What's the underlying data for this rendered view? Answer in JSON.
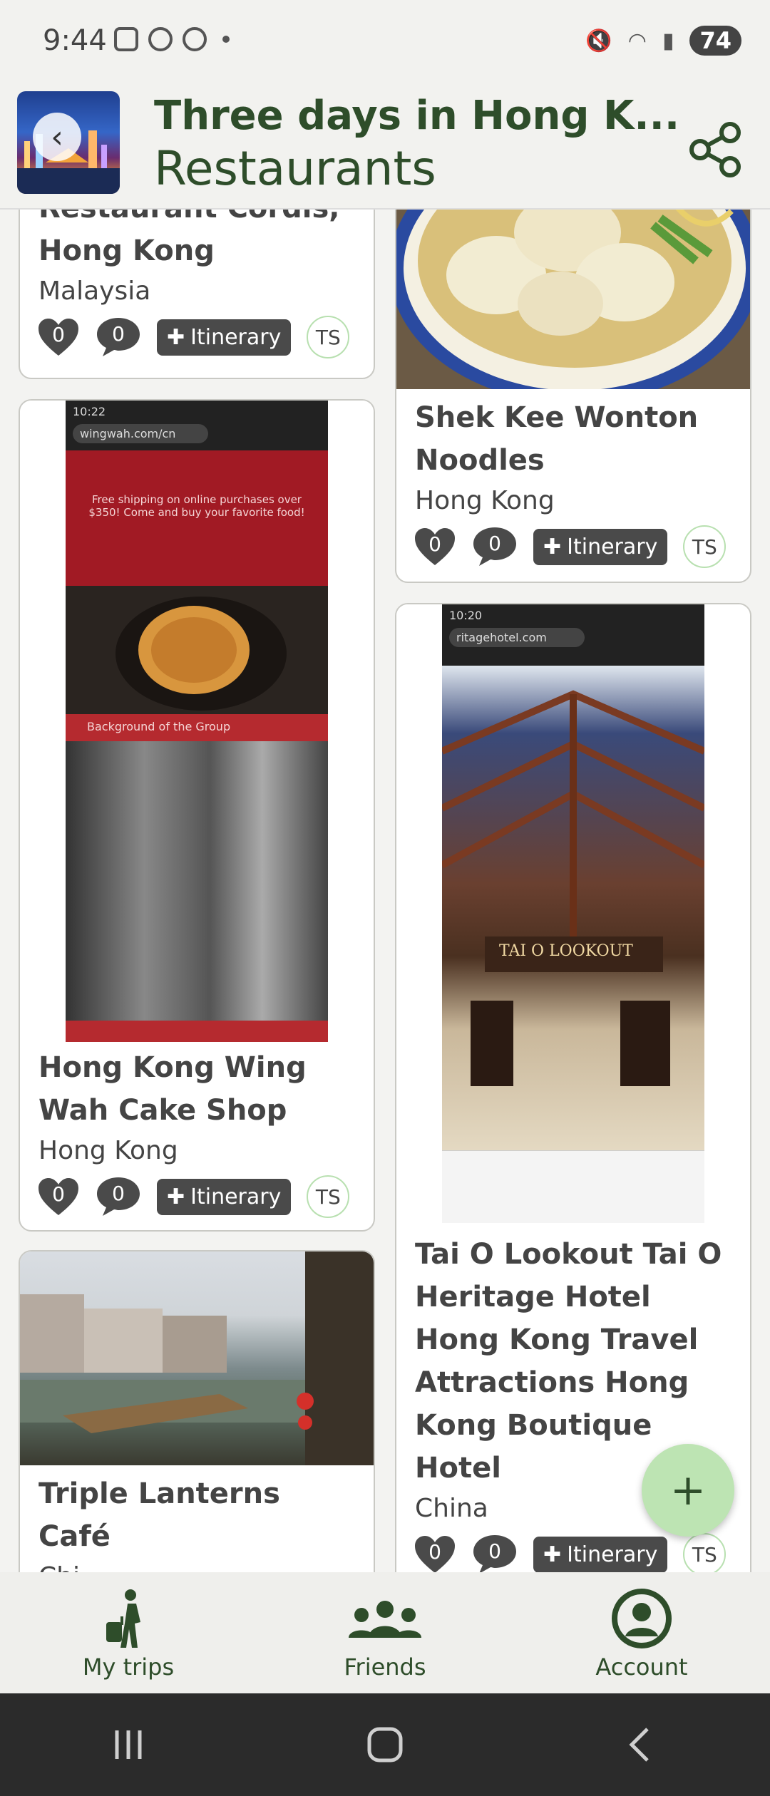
{
  "status_bar": {
    "time": "9:44",
    "battery": "74"
  },
  "header": {
    "title": "Three days in Hong K...",
    "subtitle": "Restaurants"
  },
  "cards": [
    {
      "name": "Restaurant Cordis, Hong Kong",
      "country": "Malaysia",
      "likes": "0",
      "comments": "0",
      "itinerary_label": "Itinerary",
      "user": "TS"
    },
    {
      "name": "Shek Kee Wonton Noodles",
      "country": "Hong Kong",
      "likes": "0",
      "comments": "0",
      "itinerary_label": "Itinerary",
      "user": "TS"
    },
    {
      "name": "Hong Kong Wing Wah Cake Shop",
      "country": "Hong Kong",
      "likes": "0",
      "comments": "0",
      "itinerary_label": "Itinerary",
      "user": "TS",
      "screenshot_text": {
        "url": "wingwah.com/cn",
        "banner": "Free shipping on online purchases over $350! Come and buy your favorite food!",
        "section": "Background of the Group",
        "time": "10:22"
      }
    },
    {
      "name": "Tai O Lookout Tai O Heritage Hotel Hong Kong Travel Attractions Hong Kong Boutique Hotel",
      "country": "China",
      "likes": "0",
      "comments": "0",
      "itinerary_label": "Itinerary",
      "user": "TS",
      "screenshot_text": {
        "url": "ritagehotel.com",
        "sign": "TAI O LOOKOUT",
        "time": "10:20"
      }
    },
    {
      "name": "Triple Lanterns Café",
      "country": "Chi..."
    }
  ],
  "fab": {
    "icon": "plus-icon"
  },
  "bottom_nav": [
    {
      "label": "My trips",
      "icon": "traveler-icon"
    },
    {
      "label": "Friends",
      "icon": "group-icon"
    },
    {
      "label": "Account",
      "icon": "account-icon"
    }
  ]
}
